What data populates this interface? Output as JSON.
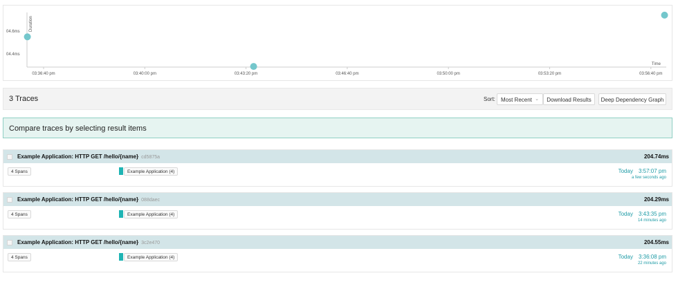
{
  "chart_data": {
    "type": "scatter",
    "xlabel": "Time",
    "ylabel": "Duration",
    "y_ticks": [
      "04.6ms",
      "04.4ms"
    ],
    "x_ticks": [
      "03:36:40 pm",
      "03:40:00 pm",
      "03:43:20 pm",
      "03:46:40 pm",
      "03:50:00 pm",
      "03:53:20 pm",
      "03:56:40 pm"
    ],
    "points": [
      {
        "time": "03:36:08 pm",
        "duration_ms": 204.55
      },
      {
        "time": "03:43:35 pm",
        "duration_ms": 204.29
      },
      {
        "time": "03:57:07 pm",
        "duration_ms": 204.74
      }
    ],
    "color": "#74c7cc"
  },
  "results": {
    "count_label": "3 Traces",
    "sort_label": "Sort:",
    "sort_value": "Most Recent",
    "download_button": "Download Results",
    "ddg_button": "Deep Dependency Graph"
  },
  "compare_banner": "Compare traces by selecting result items",
  "traces": [
    {
      "title": "Example Application: HTTP GET /hello/{name}",
      "id": "cd5875a",
      "duration": "204.74ms",
      "spans": "4 Spans",
      "service": "Example Application (4)",
      "day": "Today",
      "time": "3:57:07 pm",
      "ago": "a few seconds ago"
    },
    {
      "title": "Example Application: HTTP GET /hello/{name}",
      "id": "088daec",
      "duration": "204.29ms",
      "spans": "4 Spans",
      "service": "Example Application (4)",
      "day": "Today",
      "time": "3:43:35 pm",
      "ago": "14 minutes ago"
    },
    {
      "title": "Example Application: HTTP GET /hello/{name}",
      "id": "3c2e470",
      "duration": "204.55ms",
      "spans": "4 Spans",
      "service": "Example Application (4)",
      "day": "Today",
      "time": "3:36:08 pm",
      "ago": "22 minutes ago"
    }
  ],
  "colors": {
    "accent": "#1fb4b4",
    "trace_header": "#d3e5e8",
    "compare_bg": "#e6f4f1",
    "compare_border": "#8fcfc3"
  }
}
